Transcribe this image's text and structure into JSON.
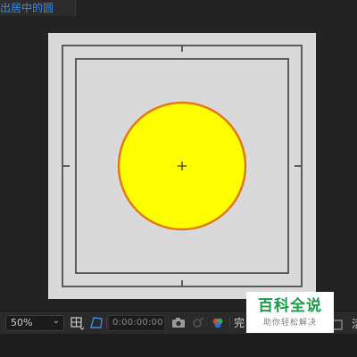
{
  "tab": {
    "title": "出居中的圆"
  },
  "composition": {
    "background_color": "#d9d9d9",
    "circle": {
      "fill": "#ffff00",
      "stroke": "#e07a14"
    }
  },
  "toolbar": {
    "zoom_value": "50%",
    "timecode": "0:00:00:00",
    "resolution_label": "完",
    "right_cut_label": "活"
  },
  "watermark": {
    "main": "百科全说",
    "sub": "助你轻松解决"
  },
  "icons": {
    "grid": "grid-toggle-icon",
    "mask": "mask-path-icon",
    "camera": "snapshot-camera-icon",
    "show_snapshot": "show-snapshot-icon",
    "channels": "rgb-channels-icon"
  }
}
